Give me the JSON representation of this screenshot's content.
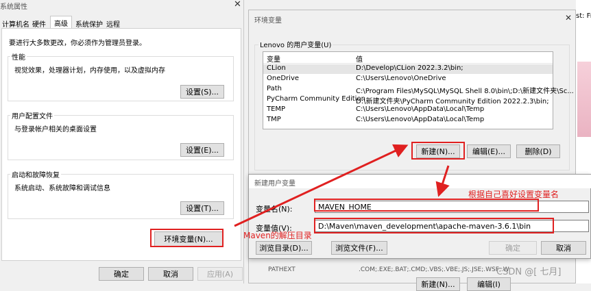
{
  "sys": {
    "title": "系统属性",
    "tabs": [
      "计算机名",
      "硬件",
      "高级",
      "系统保护",
      "远程"
    ],
    "active_tab": "高级",
    "admin_note": "要进行大多数更改，你必须作为管理员登录。",
    "performance": {
      "title": "性能",
      "desc": "视觉效果，处理器计划，内存使用，以及虚拟内存",
      "button": "设置(S)..."
    },
    "profile": {
      "title": "用户配置文件",
      "desc": "与登录帐户相关的桌面设置",
      "button": "设置(E)..."
    },
    "startup": {
      "title": "启动和故障恢复",
      "desc": "系统启动、系统故障和调试信息",
      "button": "设置(T)..."
    },
    "env_button": "环境变量(N)...",
    "ok": "确定",
    "cancel": "取消",
    "apply": "应用(A)"
  },
  "env": {
    "title": "环境变量",
    "user_group": "Lenovo 的用户变量(U)",
    "columns": [
      "变量",
      "值"
    ],
    "rows": [
      {
        "name": "CLion",
        "value": "D:\\Develop\\CLion 2022.3.2\\bin;"
      },
      {
        "name": "OneDrive",
        "value": "C:\\Users\\Lenovo\\OneDrive"
      },
      {
        "name": "Path",
        "value": "C:\\Program Files\\MySQL\\MySQL Shell 8.0\\bin\\;D:\\新建文件夹\\Sc..."
      },
      {
        "name": "PyCharm Community Edition",
        "value": "D:\\新建文件夹\\PyCharm Community Edition 2022.2.3\\bin;"
      },
      {
        "name": "TEMP",
        "value": "C:\\Users\\Lenovo\\AppData\\Local\\Temp"
      },
      {
        "name": "TMP",
        "value": "C:\\Users\\Lenovo\\AppData\\Local\\Temp"
      }
    ],
    "new_button": "新建(N)...",
    "edit_button": "编辑(E)...",
    "delete_button": "删除(D)",
    "sys_peek": "PATHEXT",
    "sys_peek_value": ".COM;.EXE;.BAT;.CMD;.VBS;.VBE;.JS;.JSE;.WSF;.WSH;.MSC",
    "bottom_edit": "编辑(I)"
  },
  "newvar": {
    "title": "新建用户变量",
    "name_label": "变量名(N):",
    "name_value": "MAVEN_HOME",
    "value_label": "变量值(V):",
    "value_value": "D:\\Maven\\maven_development\\apache-maven-3.6.1\\bin",
    "browse_dir": "浏览目录(D)...",
    "browse_file": "浏览文件(F)...",
    "ok": "确定",
    "cancel": "取消"
  },
  "annotations": {
    "var_name_hint": "根据自己喜好设置变量名",
    "maven_dir_hint": "Maven的解压目录"
  },
  "right_strip": {
    "text": "st: Fre"
  },
  "watermark": "CSDN @[ 七月]"
}
